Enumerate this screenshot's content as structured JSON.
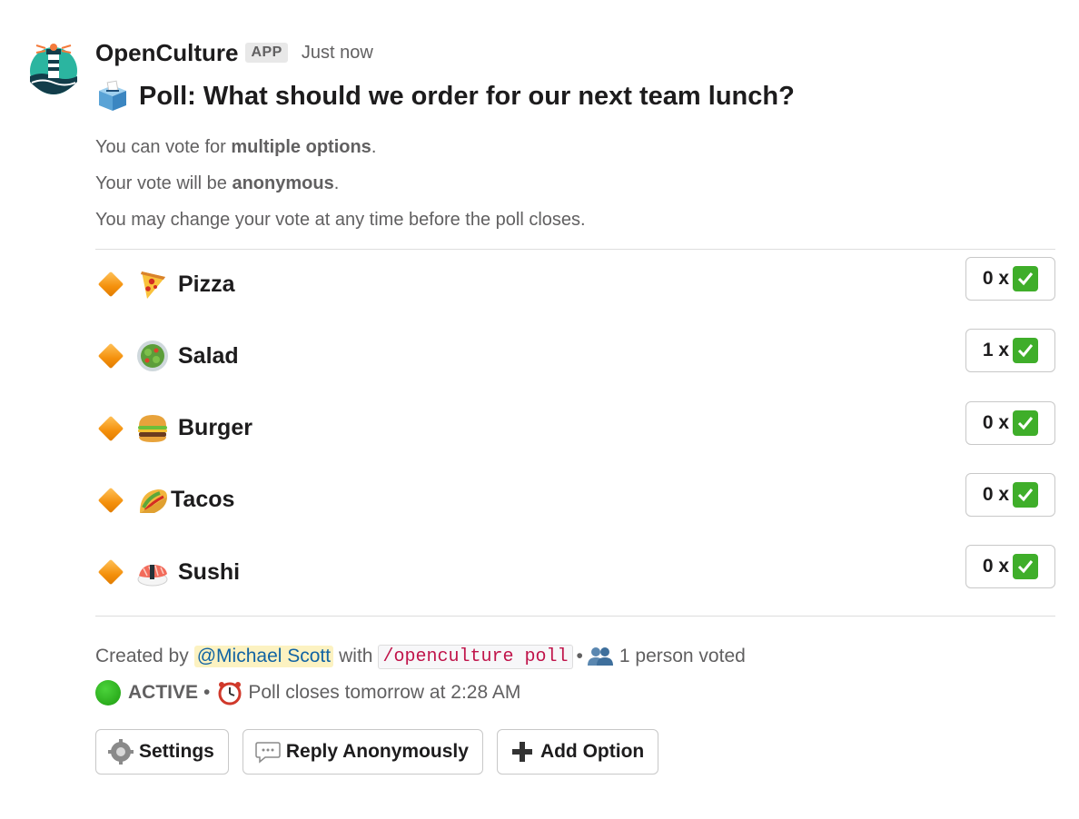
{
  "app": {
    "name": "OpenCulture",
    "badge": "APP",
    "timestamp": "Just now"
  },
  "poll": {
    "title": "Poll: What should we order for our next team lunch?",
    "title_icon": "ballot-box-icon",
    "description": {
      "line1_prefix": "You can vote for ",
      "line1_bold": "multiple options",
      "line1_suffix": ".",
      "line2_prefix": "Your vote will be ",
      "line2_bold": "anonymous",
      "line2_suffix": ".",
      "line3": "You may change your vote at any time before the poll closes."
    },
    "options": [
      {
        "label": "Pizza",
        "icon": "pizza-icon",
        "count": "0 x"
      },
      {
        "label": "Salad",
        "icon": "salad-icon",
        "count": "1 x"
      },
      {
        "label": "Burger",
        "icon": "burger-icon",
        "count": "0 x"
      },
      {
        "label": "Tacos",
        "icon": "taco-icon",
        "count": "0 x"
      },
      {
        "label": "Sushi",
        "icon": "sushi-icon",
        "count": "0 x"
      }
    ]
  },
  "footer": {
    "created_by": "Created by",
    "author": "@Michael Scott",
    "with": "with",
    "command": "/openculture poll",
    "bullet": "•",
    "voted": "1 person voted",
    "status": "ACTIVE",
    "closes": "Poll closes tomorrow at 2:28 AM"
  },
  "actions": {
    "settings": "Settings",
    "reply": "Reply Anonymously",
    "add_option": "Add Option"
  },
  "colors": {
    "mention_bg": "#fcf2c1",
    "mention_text": "#1264a3",
    "code_text": "#c0144a",
    "check_green": "#3fae2a",
    "active_green": "#2eb81f",
    "diamond_orange": "#f4900c"
  }
}
